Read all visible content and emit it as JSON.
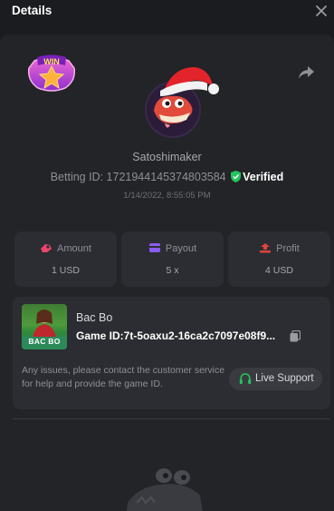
{
  "header": {
    "title": "Details"
  },
  "icons": {
    "close": "close-icon",
    "share": "share-icon",
    "win_badge": "win-badge-icon",
    "verified": "shield-check-icon",
    "amount": "amount-icon",
    "payout": "payout-icon",
    "profit": "profit-icon",
    "copy": "copy-icon",
    "support": "headset-icon"
  },
  "badge": {
    "text": "WIN"
  },
  "user": {
    "name": "Satoshimaker",
    "betting_id_label": "Betting ID: 1721944145374803584",
    "verified_label": "Verified",
    "date": "1/14/2022, 8:55:05 PM"
  },
  "stats": [
    {
      "label": "Amount",
      "value": "1 USD",
      "color": "#e8476b"
    },
    {
      "label": "Payout",
      "value": "5 x",
      "color": "#8a5cf6"
    },
    {
      "label": "Profit",
      "value": "4 USD",
      "color": "#e0443e"
    }
  ],
  "game": {
    "thumb_label": "BAC BO",
    "name": "Bac Bo",
    "id_text": "Game ID:7t-5oaxu2-16ca2c7097e08f9..."
  },
  "support": {
    "message": "Any issues, please contact the customer service for help and provide the game ID.",
    "button_label": "Live Support"
  },
  "colors": {
    "verified_green": "#22c55e",
    "background": "#1b1c1f",
    "panel": "#232428",
    "card": "#2c2d32"
  }
}
